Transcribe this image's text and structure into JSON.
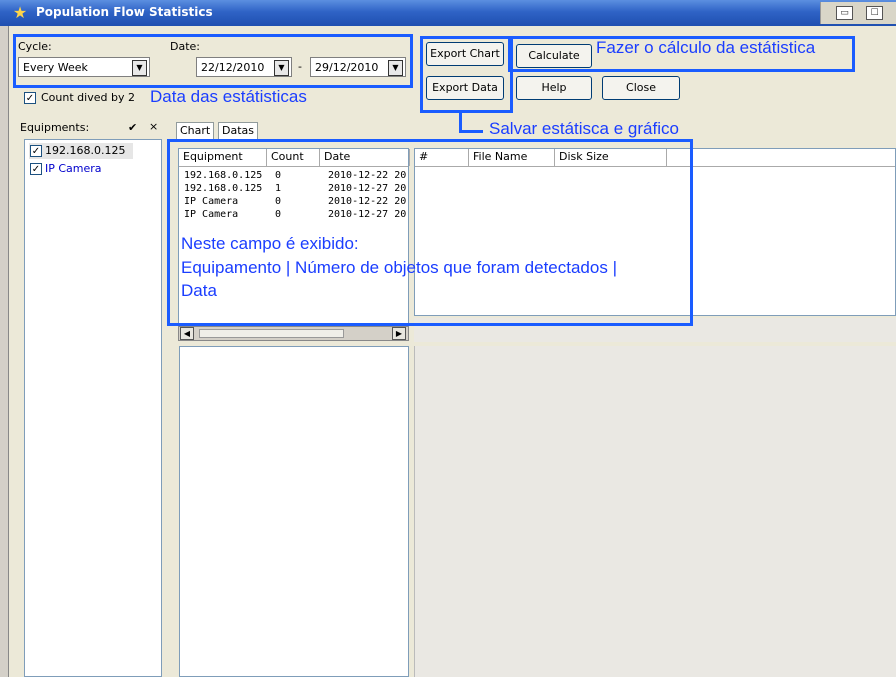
{
  "window": {
    "title": "Population Flow Statistics"
  },
  "filters": {
    "cycle_label": "Cycle:",
    "cycle_value": "Every Week",
    "date_label": "Date:",
    "date_from": "22/12/2010",
    "date_sep": "-",
    "date_to": "29/12/2010",
    "count_divided_label": "Count dived by 2"
  },
  "buttons": {
    "export_chart": "Export Chart",
    "export_data": "Export Data",
    "calculate": "Calculate",
    "help": "Help",
    "close": "Close"
  },
  "equipments": {
    "label": "Equipments:",
    "check_all": "✔",
    "clear": "×",
    "items": [
      {
        "name": "192.168.0.125",
        "checked": true
      },
      {
        "name": "IP Camera",
        "checked": true
      }
    ]
  },
  "tabs": [
    "Chart",
    "Datas"
  ],
  "stats_table": {
    "columns": [
      "Equipment",
      "Count",
      "Date"
    ],
    "rows": [
      [
        "192.168.0.125",
        "0",
        "2010-12-22 20"
      ],
      [
        "192.168.0.125",
        "1",
        "2010-12-27 20"
      ],
      [
        "IP Camera",
        "0",
        "2010-12-22 20"
      ],
      [
        "IP Camera",
        "0",
        "2010-12-27 20"
      ]
    ]
  },
  "files_table": {
    "columns": [
      "#",
      "File Name",
      "Disk Size"
    ]
  },
  "annotations": {
    "calc": "Fazer o cálculo da estátistica",
    "date": "Data das estátisticas",
    "save": "Salvar estátisca e gráfico",
    "field_line1": "Neste campo é exibido:",
    "field_line2": "Equipamento | Número de objetos que foram detectados |",
    "field_line3": "Data"
  },
  "colors": {
    "annotation": "#1a3dff",
    "titlebar": "#2f63c6",
    "link_text": "#0000cc"
  }
}
